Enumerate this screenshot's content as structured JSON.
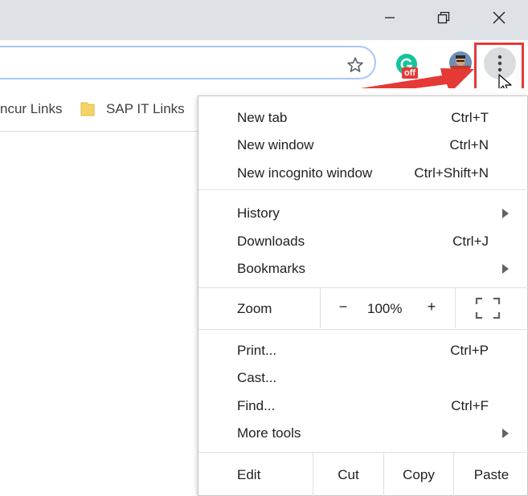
{
  "bookmarks": [
    {
      "label": "ncur Links"
    },
    {
      "label": "SAP IT Links"
    }
  ],
  "grammarly_badge": "off",
  "menu": {
    "items": [
      {
        "label": "New tab",
        "shortcut": "Ctrl+T"
      },
      {
        "label": "New window",
        "shortcut": "Ctrl+N"
      },
      {
        "label": "New incognito window",
        "shortcut": "Ctrl+Shift+N"
      },
      {
        "label": "History",
        "shortcut": ""
      },
      {
        "label": "Downloads",
        "shortcut": "Ctrl+J"
      },
      {
        "label": "Bookmarks",
        "shortcut": ""
      },
      {
        "label": "Print...",
        "shortcut": "Ctrl+P"
      },
      {
        "label": "Cast...",
        "shortcut": ""
      },
      {
        "label": "Find...",
        "shortcut": "Ctrl+F"
      },
      {
        "label": "More tools",
        "shortcut": ""
      }
    ],
    "zoom": {
      "label": "Zoom",
      "minus": "−",
      "value": "100%",
      "plus": "+"
    },
    "edit": {
      "label": "Edit",
      "cut": "Cut",
      "copy": "Copy",
      "paste": "Paste"
    }
  },
  "icons": {
    "minimize": "minimize-icon",
    "restore": "restore-icon",
    "close": "close-icon",
    "bookmark_star": "star-icon",
    "extension": "grammarly-icon",
    "profile": "avatar",
    "menu": "three-dot-menu-icon",
    "submenu": "submenu-arrow-icon",
    "fullscreen": "fullscreen-icon",
    "folder": "folder-icon"
  },
  "colors": {
    "titlebar": "#dee1e6",
    "omnibox_border": "#a8c7fa",
    "highlight": "#e53935",
    "grammarly": "#15c39a",
    "folder": "#f5d36b"
  }
}
